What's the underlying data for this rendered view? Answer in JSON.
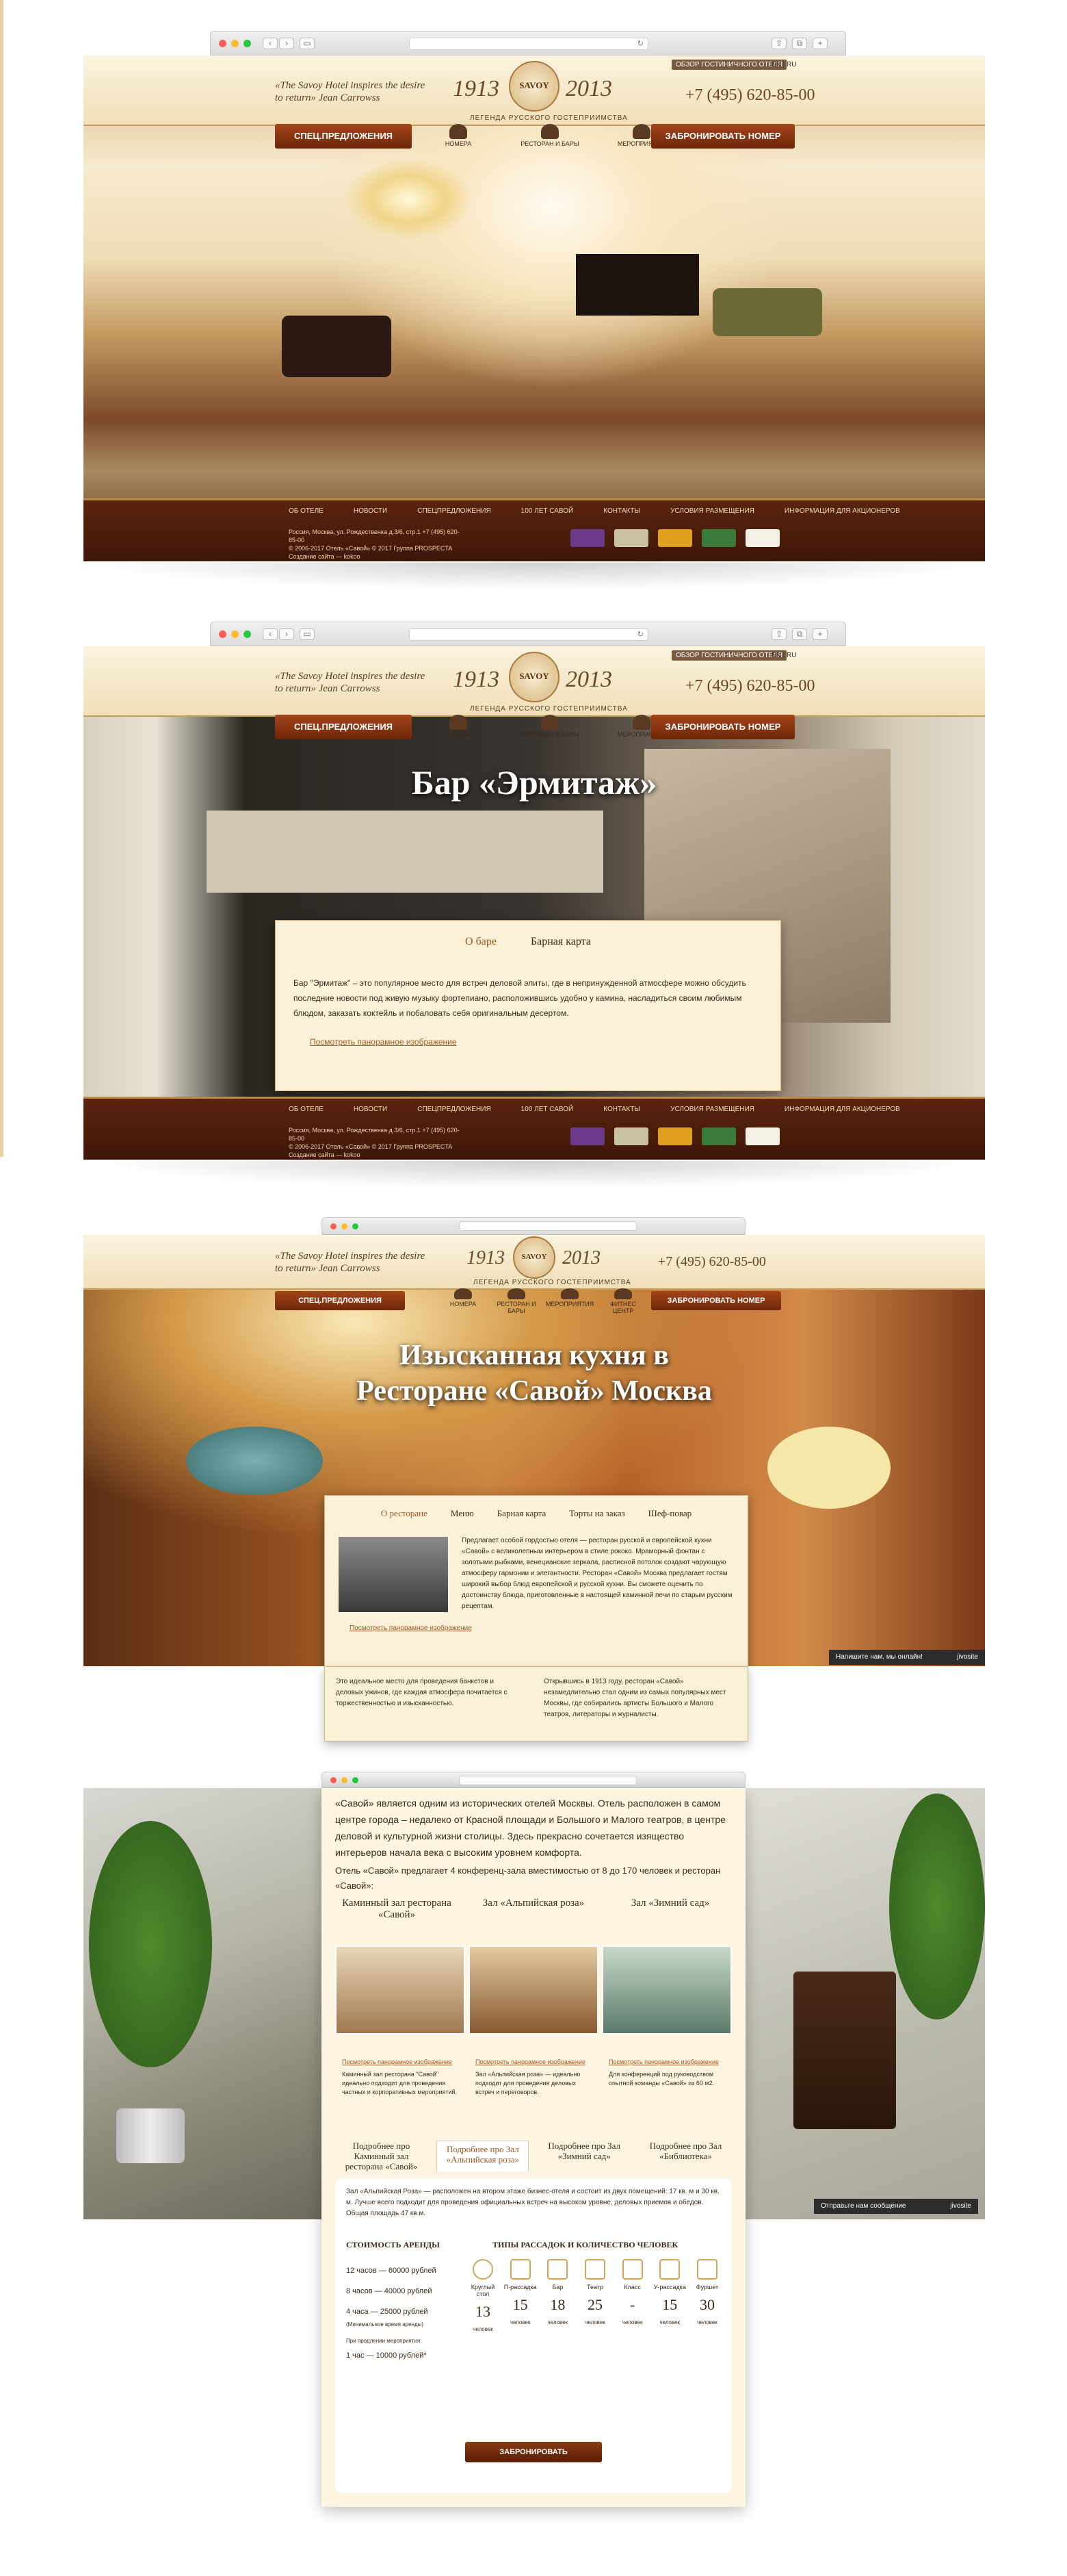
{
  "header": {
    "motto": "«The Savoy Hotel inspires the desire to return» Jean Carrowss",
    "year_left": "1913",
    "year_right": "2013",
    "logo": "SAVOY",
    "legend": "ЛЕГЕНДА РУССКОГО ГОСТЕПРИИМСТВА",
    "phone": "+7 (495) 620-85-00",
    "system": "ОБЗОР ГОСТИНИЧНОГО ОТЕЛЯ",
    "lang": "EN | RU"
  },
  "nav": {
    "special": "СПЕЦ.ПРЕДЛОЖЕНИЯ",
    "book": "ЗАБРОНИРОВАТЬ НОМЕР",
    "items": [
      "НОМЕРА",
      "РЕСТОРАН И БАРЫ",
      "МЕРОПРИЯТИЯ",
      "ФИТНЕС ЦЕНТР"
    ]
  },
  "footer": {
    "links": [
      "ОБ ОТЕЛЕ",
      "НОВОСТИ",
      "СПЕЦПРЕДЛОЖЕНИЯ",
      "100 ЛЕТ САВОЙ",
      "КОНТАКТЫ",
      "УСЛОВИЯ РАЗМЕЩЕНИЯ",
      "ИНФОРМАЦИЯ ДЛЯ АКЦИОНЕРОВ"
    ],
    "address": "Россия, Москва, ул. Рождественка д.3/6, стр.1 +7 (495) 620-85-00",
    "copy": "© 2006-2017 Отель «Савой» © 2017 Группа PROSPECTA",
    "credit": "Создание сайта — kokoo"
  },
  "bar": {
    "title": "Бар «Эрмитаж»",
    "tabs": [
      "О баре",
      "Барная карта"
    ],
    "text": "Бар \"Эрмитаж\" – это популярное место для встреч деловой элиты, где в непринужденной атмосфере можно обсудить последние новости под живую музыку фортепиано, расположившись удобно у камина, насладиться своим любимым блюдом, заказать коктейль и побаловать себя оригинальным десертом.",
    "link": "Посмотреть панорамное изображение"
  },
  "rest": {
    "title1": "Изысканная кухня в",
    "title2": "Ресторане «Савой» Москва",
    "tabs": [
      "О ресторане",
      "Меню",
      "Барная карта",
      "Торты на заказ",
      "Шеф-повар"
    ],
    "text": "Предлагает особой гордостью отеля — ресторан русской и европейской кухни «Савой» с великолепным интерьером в стиле рококо. Мраморный фонтан с золотыми рыбками, венецианские зеркала, расписной потолок создают чарующую атмосферу гармонии и элегантности. Ресторан «Савой» Москва предлагает гостям широкий выбор блюд европейской и русской кухни. Вы сможете оценить по достоинству блюда, приготовленные в настоящей каминной печи по старым русским рецептам.",
    "link": "Посмотреть панорамное изображение",
    "col1": "Это идеальное место для проведения банкетов и деловых ужинов, где каждая атмосфера почитается с торжественностью и изысканностью.",
    "col2": "Открывшись в 1913 году, ресторан «Савой» незамедлительно стал одним из самых популярных мест Москвы, где собирались артисты Большого и Малого театров, литераторы и журналисты.",
    "chat": "Напишите нам, мы онлайн!",
    "chat_brand": "jivosite"
  },
  "conf": {
    "intro": "«Савой» является одним из исторических отелей Москвы. Отель расположен в самом центре города – недалеко от Красной площади и Большого и Малого театров, в центре деловой и культурной жизни столицы. Здесь прекрасно сочетается изящество интерьеров начала века с высоким уровнем комфорта.",
    "intro2": "Отель «Савой» предлагает 4 конференц-зала вместимостью от 8 до 170 человек и ресторан «Савой»:",
    "halls": [
      "Каминный зал ресторана «Савой»",
      "Зал «Альпийская роза»",
      "Зал «Зимний сад»"
    ],
    "hall_link": "Посмотреть панорамное изображение",
    "hall_desc": [
      "Каминный зал ресторана \"Савой\" идеально подходит для проведения частных и корпоративных мероприятий.",
      "Зал «Альпийская роза» — идеально подходит для проведения деловых встреч и переговоров.",
      "Для конференций под руководством опытной команды «Савой» из 60 м2."
    ],
    "tabs": [
      "Подробнее про Каминный зал ресторана «Савой»",
      "Подробнее про Зал «Альпийская роза»",
      "Подробнее про Зал «Зимний сад»",
      "Подробнее про Зал «Библиотека»"
    ],
    "hall_text": "Зал «Альпийская Роза» — расположен на втором этаже бизнес-отеля и состоит из двух помещений: 17 кв. м и 30 кв. м. Лучше всего подходит для проведения официальных встреч на высоком уровне, деловых приемов и обедов. Общая площадь 47 кв.м.",
    "price_title": "СТОИМОСТЬ АРЕНДЫ",
    "prices": [
      "12 часов — 60000 рублей",
      "8 часов — 40000 рублей",
      "4 часа — 25000 рублей"
    ],
    "price_note": "(Минимальное время аренды)",
    "extra_label": "При продлении мероприятия:",
    "extra": "1 час — 10000 рублей*",
    "seat_title": "ТИПЫ РАССАДОК И КОЛИЧЕСТВО ЧЕЛОВЕК",
    "seats": [
      {
        "n": "Круглый стол",
        "v": "13"
      },
      {
        "n": "П-рассадка",
        "v": "15"
      },
      {
        "n": "Бар",
        "v": "18"
      },
      {
        "n": "Театр",
        "v": "25"
      },
      {
        "n": "Класс",
        "v": "-"
      },
      {
        "n": "У-рассадка",
        "v": "15"
      },
      {
        "n": "Фуршет",
        "v": "30"
      }
    ],
    "unit": "человек",
    "book": "ЗАБРОНИРОВАТЬ",
    "chat": "Отправьте нам сообщение",
    "chat_brand": "jivosite"
  }
}
